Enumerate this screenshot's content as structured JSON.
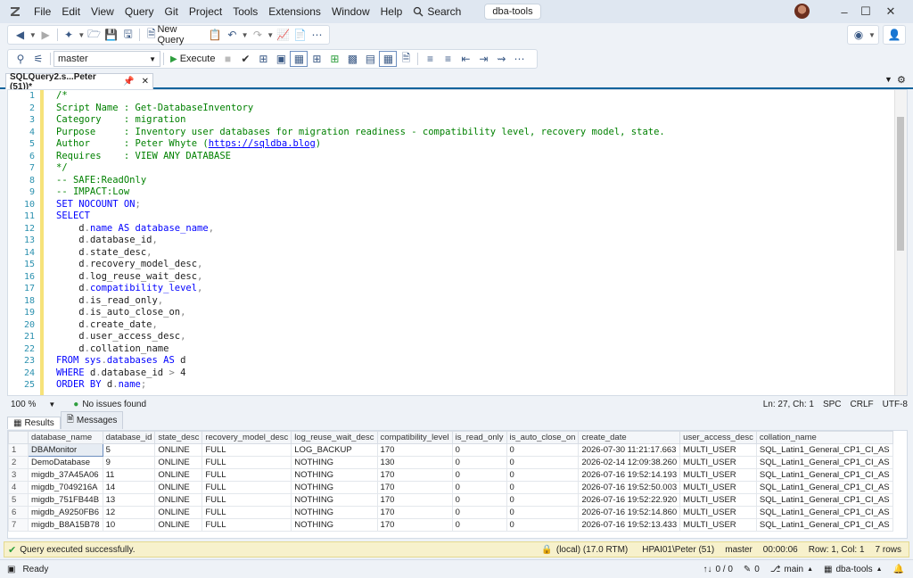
{
  "titlebar": {
    "menu": [
      "File",
      "Edit",
      "View",
      "Query",
      "Git",
      "Project",
      "Tools",
      "Extensions",
      "Window",
      "Help"
    ],
    "search_label": "Search",
    "title": "dba-tools"
  },
  "toolbar1": {
    "new_query": "New Query"
  },
  "toolbar2": {
    "database": "master",
    "execute": "Execute"
  },
  "doc_tab": {
    "title": "SQLQuery2.s...Peter (51))*"
  },
  "editor": {
    "line_numbers": [
      "1",
      "2",
      "3",
      "4",
      "5",
      "6",
      "7",
      "8",
      "9",
      "10",
      "11",
      "12",
      "13",
      "14",
      "15",
      "16",
      "17",
      "18",
      "19",
      "20",
      "21",
      "22",
      "23",
      "24",
      "25"
    ],
    "lines": [
      [
        {
          "c": "c-com",
          "t": "/*"
        }
      ],
      [
        {
          "c": "c-com",
          "t": "Script Name : Get-DatabaseInventory"
        }
      ],
      [
        {
          "c": "c-com",
          "t": "Category    : migration"
        }
      ],
      [
        {
          "c": "c-com",
          "t": "Purpose     : Inventory user databases for migration readiness - compatibility level, recovery model, state."
        }
      ],
      [
        {
          "c": "c-com",
          "t": "Author      : Peter Whyte ("
        },
        {
          "c": "c-link",
          "t": "https://sqldba.blog"
        },
        {
          "c": "c-com",
          "t": ")"
        }
      ],
      [
        {
          "c": "c-com",
          "t": "Requires    : VIEW ANY DATABASE"
        }
      ],
      [
        {
          "c": "c-com",
          "t": "*/"
        }
      ],
      [
        {
          "c": "c-com",
          "t": "-- SAFE:ReadOnly"
        }
      ],
      [
        {
          "c": "c-com",
          "t": "-- IMPACT:Low"
        }
      ],
      [
        {
          "c": "c-kw",
          "t": "SET NOCOUNT ON"
        },
        {
          "c": "c-op",
          "t": ";"
        }
      ],
      [
        {
          "c": "c-kw",
          "t": "SELECT"
        }
      ],
      [
        {
          "c": "c-id",
          "t": "    d"
        },
        {
          "c": "c-op",
          "t": "."
        },
        {
          "c": "c-kw",
          "t": "name AS database_name"
        },
        {
          "c": "c-op",
          "t": ","
        }
      ],
      [
        {
          "c": "c-id",
          "t": "    d"
        },
        {
          "c": "c-op",
          "t": "."
        },
        {
          "c": "c-id",
          "t": "database_id"
        },
        {
          "c": "c-op",
          "t": ","
        }
      ],
      [
        {
          "c": "c-id",
          "t": "    d"
        },
        {
          "c": "c-op",
          "t": "."
        },
        {
          "c": "c-id",
          "t": "state_desc"
        },
        {
          "c": "c-op",
          "t": ","
        }
      ],
      [
        {
          "c": "c-id",
          "t": "    d"
        },
        {
          "c": "c-op",
          "t": "."
        },
        {
          "c": "c-id",
          "t": "recovery_model_desc"
        },
        {
          "c": "c-op",
          "t": ","
        }
      ],
      [
        {
          "c": "c-id",
          "t": "    d"
        },
        {
          "c": "c-op",
          "t": "."
        },
        {
          "c": "c-id",
          "t": "log_reuse_wait_desc"
        },
        {
          "c": "c-op",
          "t": ","
        }
      ],
      [
        {
          "c": "c-id",
          "t": "    d"
        },
        {
          "c": "c-op",
          "t": "."
        },
        {
          "c": "c-kw",
          "t": "compatibility_level"
        },
        {
          "c": "c-op",
          "t": ","
        }
      ],
      [
        {
          "c": "c-id",
          "t": "    d"
        },
        {
          "c": "c-op",
          "t": "."
        },
        {
          "c": "c-id",
          "t": "is_read_only"
        },
        {
          "c": "c-op",
          "t": ","
        }
      ],
      [
        {
          "c": "c-id",
          "t": "    d"
        },
        {
          "c": "c-op",
          "t": "."
        },
        {
          "c": "c-id",
          "t": "is_auto_close_on"
        },
        {
          "c": "c-op",
          "t": ","
        }
      ],
      [
        {
          "c": "c-id",
          "t": "    d"
        },
        {
          "c": "c-op",
          "t": "."
        },
        {
          "c": "c-id",
          "t": "create_date"
        },
        {
          "c": "c-op",
          "t": ","
        }
      ],
      [
        {
          "c": "c-id",
          "t": "    d"
        },
        {
          "c": "c-op",
          "t": "."
        },
        {
          "c": "c-id",
          "t": "user_access_desc"
        },
        {
          "c": "c-op",
          "t": ","
        }
      ],
      [
        {
          "c": "c-id",
          "t": "    d"
        },
        {
          "c": "c-op",
          "t": "."
        },
        {
          "c": "c-id",
          "t": "collation_name"
        }
      ],
      [
        {
          "c": "c-kw",
          "t": "FROM "
        },
        {
          "c": "c-fn",
          "t": "sys"
        },
        {
          "c": "c-op",
          "t": "."
        },
        {
          "c": "c-fn",
          "t": "databases"
        },
        {
          "c": "c-kw",
          "t": " AS "
        },
        {
          "c": "c-id",
          "t": "d"
        }
      ],
      [
        {
          "c": "c-kw",
          "t": "WHERE "
        },
        {
          "c": "c-id",
          "t": "d"
        },
        {
          "c": "c-op",
          "t": "."
        },
        {
          "c": "c-id",
          "t": "database_id "
        },
        {
          "c": "c-op",
          "t": "> "
        },
        {
          "c": "c-id",
          "t": "4"
        }
      ],
      [
        {
          "c": "c-kw",
          "t": "ORDER BY "
        },
        {
          "c": "c-id",
          "t": "d"
        },
        {
          "c": "c-op",
          "t": "."
        },
        {
          "c": "c-kw",
          "t": "name"
        },
        {
          "c": "c-op",
          "t": ";"
        }
      ]
    ]
  },
  "editor_status": {
    "zoom": "100 %",
    "issues": "No issues found",
    "position": "Ln: 27, Ch: 1",
    "spc": "SPC",
    "crlf": "CRLF",
    "encoding": "UTF-8"
  },
  "results_tabs": {
    "results": "Results",
    "messages": "Messages"
  },
  "grid": {
    "columns": [
      "database_name",
      "database_id",
      "state_desc",
      "recovery_model_desc",
      "log_reuse_wait_desc",
      "compatibility_level",
      "is_read_only",
      "is_auto_close_on",
      "create_date",
      "user_access_desc",
      "collation_name"
    ],
    "rows": [
      [
        "1",
        "DBAMonitor",
        "5",
        "ONLINE",
        "FULL",
        "LOG_BACKUP",
        "170",
        "0",
        "0",
        "2026-07-30 11:21:17.663",
        "MULTI_USER",
        "SQL_Latin1_General_CP1_CI_AS"
      ],
      [
        "2",
        "DemoDatabase",
        "9",
        "ONLINE",
        "FULL",
        "NOTHING",
        "130",
        "0",
        "0",
        "2026-02-14 12:09:38.260",
        "MULTI_USER",
        "SQL_Latin1_General_CP1_CI_AS"
      ],
      [
        "3",
        "migdb_37A45A06",
        "11",
        "ONLINE",
        "FULL",
        "NOTHING",
        "170",
        "0",
        "0",
        "2026-07-16 19:52:14.193",
        "MULTI_USER",
        "SQL_Latin1_General_CP1_CI_AS"
      ],
      [
        "4",
        "migdb_7049216A",
        "14",
        "ONLINE",
        "FULL",
        "NOTHING",
        "170",
        "0",
        "0",
        "2026-07-16 19:52:50.003",
        "MULTI_USER",
        "SQL_Latin1_General_CP1_CI_AS"
      ],
      [
        "5",
        "migdb_751FB44B",
        "13",
        "ONLINE",
        "FULL",
        "NOTHING",
        "170",
        "0",
        "0",
        "2026-07-16 19:52:22.920",
        "MULTI_USER",
        "SQL_Latin1_General_CP1_CI_AS"
      ],
      [
        "6",
        "migdb_A9250FB6",
        "12",
        "ONLINE",
        "FULL",
        "NOTHING",
        "170",
        "0",
        "0",
        "2026-07-16 19:52:14.860",
        "MULTI_USER",
        "SQL_Latin1_General_CP1_CI_AS"
      ],
      [
        "7",
        "migdb_B8A15B78",
        "10",
        "ONLINE",
        "FULL",
        "NOTHING",
        "170",
        "0",
        "0",
        "2026-07-16 19:52:13.433",
        "MULTI_USER",
        "SQL_Latin1_General_CP1_CI_AS"
      ]
    ]
  },
  "exec_status": {
    "message": "Query executed successfully.",
    "server": "(local) (17.0 RTM)",
    "login": "HPAI01\\Peter (51)",
    "database": "master",
    "elapsed": "00:00:06",
    "rowcol": "Row: 1, Col: 1",
    "rows": "7 rows"
  },
  "statusbar": {
    "ready": "Ready",
    "changes": "0 / 0",
    "edits": "0",
    "branch": "main",
    "repo": "dba-tools"
  },
  "colors": {
    "accent": "#0e639c",
    "success": "#2e9e3e",
    "exec_bar": "#f7f1cc"
  }
}
